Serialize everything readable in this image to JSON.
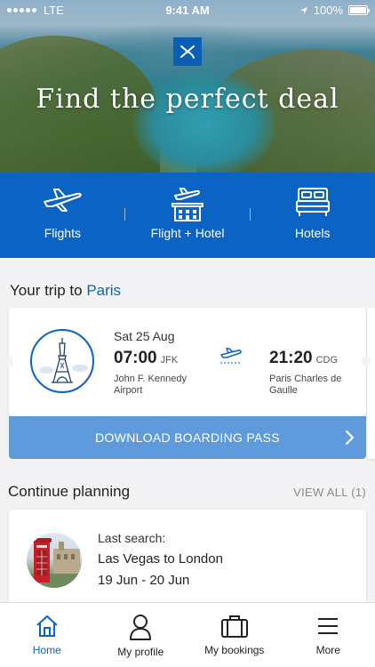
{
  "status_bar": {
    "carrier": "LTE",
    "time": "9:41 AM",
    "battery": "100%"
  },
  "hero": {
    "title": "Find the perfect deal"
  },
  "nav": {
    "items": [
      {
        "label": "Flights",
        "icon": "plane-icon"
      },
      {
        "label": "Flight + Hotel",
        "icon": "flight-hotel-icon"
      },
      {
        "label": "Hotels",
        "icon": "bed-icon"
      }
    ]
  },
  "trip": {
    "heading_prefix": "Your trip to",
    "destination": "Paris",
    "date": "Sat 25 Aug",
    "departure": {
      "time": "07:00",
      "code": "JFK",
      "name": "John F. Kennedy Airport"
    },
    "arrival": {
      "time": "21:20",
      "code": "CDG",
      "name": "Paris Charles de Gaulle"
    },
    "boarding_button": "DOWNLOAD BOARDING PASS"
  },
  "planning": {
    "heading": "Continue planning",
    "view_all": "VIEW ALL (1)",
    "card": {
      "label": "Last search:",
      "route": "Las Vegas to London",
      "dates": "19 Jun - 20 Jun"
    }
  },
  "tab_bar": {
    "tabs": [
      {
        "label": "Home",
        "icon": "home-icon",
        "active": true
      },
      {
        "label": "My profile",
        "icon": "user-icon",
        "active": false
      },
      {
        "label": "My bookings",
        "icon": "briefcase-icon",
        "active": false
      },
      {
        "label": "More",
        "icon": "menu-icon",
        "active": false
      }
    ]
  },
  "colors": {
    "brand_blue": "#0b63c4",
    "button_blue": "#5f9bdc"
  }
}
